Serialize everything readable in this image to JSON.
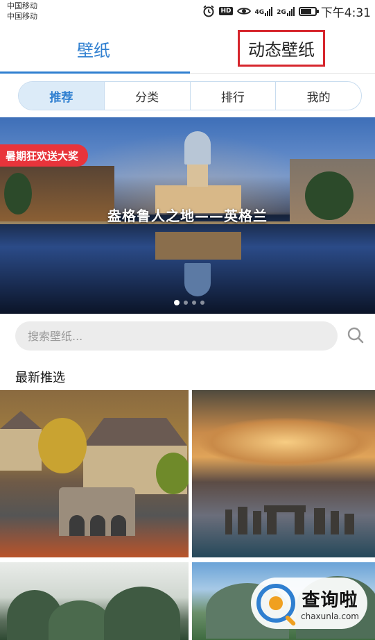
{
  "status_bar": {
    "carrier1": "中国移动",
    "carrier2": "中国移动",
    "hd": "HD",
    "net1": "4G",
    "net2": "2G",
    "time": "下午4:31",
    "battery_level": 0.75
  },
  "top_tabs": [
    {
      "label": "壁纸",
      "active": true
    },
    {
      "label": "动态壁纸",
      "active": false,
      "highlighted": true
    }
  ],
  "segments": [
    "推荐",
    "分类",
    "排行",
    "我的"
  ],
  "banner": {
    "promo": "暑期狂欢送大奖",
    "caption": "盎格鲁人之地——英格兰",
    "slide_count": 4,
    "active_slide": 0
  },
  "search": {
    "placeholder": "搜索壁纸..."
  },
  "section": {
    "title": "最新推选"
  },
  "watermark": {
    "cn": "查询啦",
    "en": "chaxunla.com"
  },
  "colors": {
    "accent": "#2f7fd0",
    "highlight_box": "#d6262d",
    "promo": "#e8343b"
  }
}
